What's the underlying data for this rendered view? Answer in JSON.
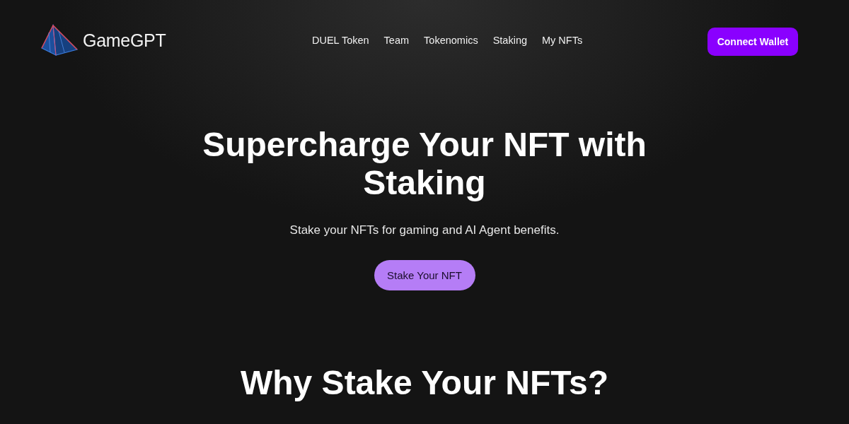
{
  "header": {
    "logo_text": "GameGPT",
    "nav": [
      {
        "label": "DUEL Token"
      },
      {
        "label": "Team"
      },
      {
        "label": "Tokenomics"
      },
      {
        "label": "Staking"
      },
      {
        "label": "My NFTs"
      }
    ],
    "connect_button": "Connect Wallet"
  },
  "hero": {
    "title": "Supercharge Your NFT with Staking",
    "subtitle": "Stake your NFTs for gaming and AI Agent benefits.",
    "button": "Stake Your NFT"
  },
  "section": {
    "title": "Why Stake Your NFTs?"
  }
}
